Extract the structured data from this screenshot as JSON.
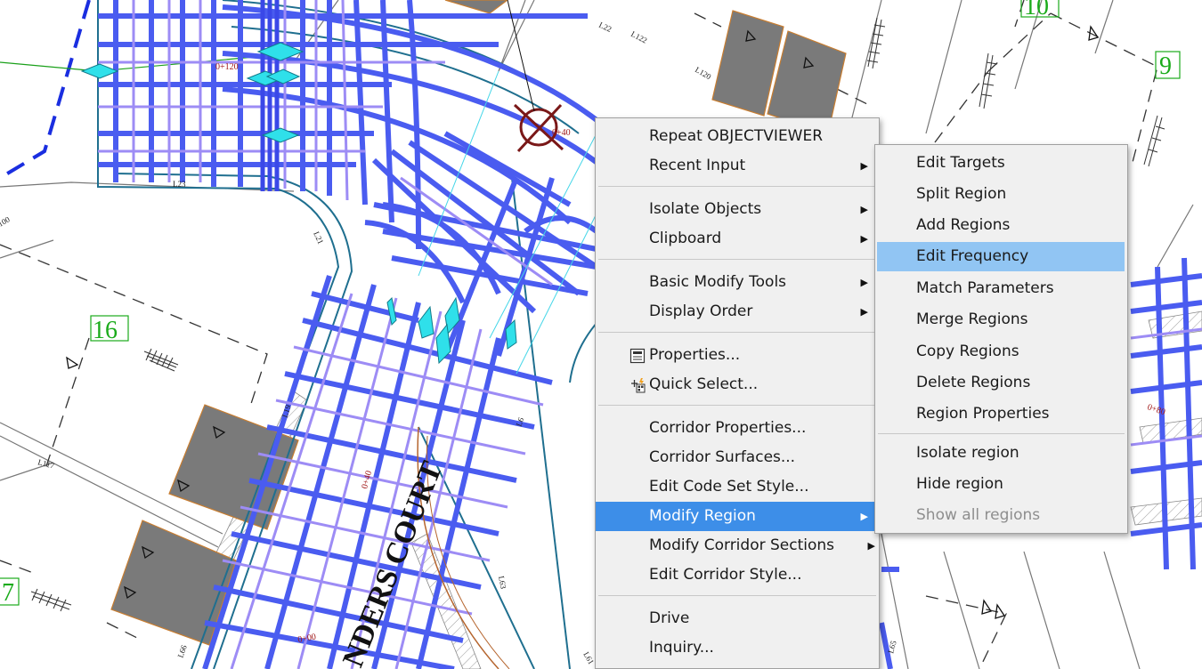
{
  "drawing": {
    "street_name": "NDERS COURT",
    "lot_numbers": [
      "10",
      "9",
      "16",
      "7"
    ],
    "line_labels": [
      "L23",
      "L22",
      "L21",
      "L19",
      "L122",
      "L120",
      "L117",
      "L6",
      "L63",
      "L65",
      "L61",
      "L66",
      "L64"
    ],
    "station_labels": [
      "0+120",
      "0+40",
      "0+80",
      "0+40",
      "0+00"
    ],
    "misc_labels": [
      "100"
    ]
  },
  "context_menu": {
    "items": [
      {
        "label": "Repeat OBJECTVIEWER",
        "submenu": false
      },
      {
        "label": "Recent Input",
        "submenu": true
      },
      {
        "label": "Isolate Objects",
        "submenu": true
      },
      {
        "label": "Clipboard",
        "submenu": true
      },
      {
        "label": "Basic Modify Tools",
        "submenu": true
      },
      {
        "label": "Display Order",
        "submenu": true
      },
      {
        "label": "Properties...",
        "submenu": false,
        "icon": "properties-icon"
      },
      {
        "label": "Quick Select...",
        "submenu": false,
        "icon": "quick-select-icon"
      },
      {
        "label": "Corridor Properties...",
        "submenu": false
      },
      {
        "label": "Corridor Surfaces...",
        "submenu": false
      },
      {
        "label": "Edit Code Set Style...",
        "submenu": false
      },
      {
        "label": "Modify Region",
        "submenu": true,
        "selected": true
      },
      {
        "label": "Modify Corridor Sections",
        "submenu": true
      },
      {
        "label": "Edit Corridor Style...",
        "submenu": false
      },
      {
        "label": "Drive",
        "submenu": false
      },
      {
        "label": "Inquiry...",
        "submenu": false
      }
    ]
  },
  "submenu": {
    "items": [
      {
        "label": "Edit Targets"
      },
      {
        "label": "Split Region"
      },
      {
        "label": "Add Regions"
      },
      {
        "label": "Edit Frequency",
        "highlighted": true
      },
      {
        "label": "Match Parameters"
      },
      {
        "label": "Merge Regions"
      },
      {
        "label": "Copy Regions"
      },
      {
        "label": "Delete Regions"
      },
      {
        "label": "Region Properties"
      },
      {
        "label": "Isolate region"
      },
      {
        "label": "Hide region"
      },
      {
        "label": "Show all regions",
        "disabled": true
      }
    ]
  },
  "colors": {
    "corridor_blue": "#4a5cf0",
    "corridor_light": "#9d8cf5",
    "corridor_edge": "#1f6f8f",
    "lot_number_green": "#1bab1b",
    "selection_blue": "#3d8ee8",
    "submenu_highlight": "#91c5f3",
    "grip_cyan": "#2fe0ea",
    "building_gray": "#7a7a7a"
  }
}
